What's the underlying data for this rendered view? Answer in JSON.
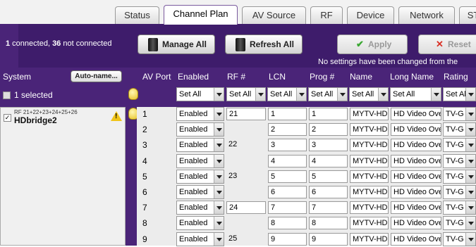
{
  "tabs": [
    "Status",
    "Channel Plan",
    "AV Source",
    "RF",
    "Device",
    "Network",
    "ST"
  ],
  "active_tab": "Channel Plan",
  "toolbar": {
    "connected_count": "1",
    "connected_label": " connected, ",
    "not_connected_count": "36",
    "not_connected_label": " not connected",
    "manage_all": "Manage All",
    "refresh_all": "Refresh All",
    "apply": "Apply",
    "reset": "Reset",
    "no_changes": "No settings have been changed from the"
  },
  "headers": {
    "system": "System",
    "auto_name": "Auto-name...",
    "av_port": "AV Port",
    "enabled": "Enabled",
    "rf": "RF #",
    "lcn": "LCN",
    "prog": "Prog #",
    "name": "Name",
    "long_name": "Long Name",
    "rating": "Rating"
  },
  "set_all": {
    "selected": "1 selected",
    "label": "Set All"
  },
  "device": {
    "rf_list": "RF 21+22+23+24+25+26",
    "name": "HDbridge2"
  },
  "rows": [
    {
      "port": "1",
      "enabled": "Enabled",
      "rf": "21",
      "rf_input": true,
      "lcn": "1",
      "prog": "1",
      "name": "MYTV-HD",
      "long_name": "HD Video Ove",
      "rating": "TV-G"
    },
    {
      "port": "2",
      "enabled": "Enabled",
      "rf": "",
      "rf_input": false,
      "lcn": "2",
      "prog": "2",
      "name": "MYTV-HD",
      "long_name": "HD Video Ove",
      "rating": "TV-G"
    },
    {
      "port": "3",
      "enabled": "Enabled",
      "rf": "22",
      "rf_input": false,
      "lcn": "3",
      "prog": "3",
      "name": "MYTV-HD",
      "long_name": "HD Video Ove",
      "rating": "TV-G"
    },
    {
      "port": "4",
      "enabled": "Enabled",
      "rf": "",
      "rf_input": false,
      "lcn": "4",
      "prog": "4",
      "name": "MYTV-HD",
      "long_name": "HD Video Ove",
      "rating": "TV-G"
    },
    {
      "port": "5",
      "enabled": "Enabled",
      "rf": "23",
      "rf_input": false,
      "lcn": "5",
      "prog": "5",
      "name": "MYTV-HD",
      "long_name": "HD Video Ove",
      "rating": "TV-G"
    },
    {
      "port": "6",
      "enabled": "Enabled",
      "rf": "",
      "rf_input": false,
      "lcn": "6",
      "prog": "6",
      "name": "MYTV-HD",
      "long_name": "HD Video Ove",
      "rating": "TV-G"
    },
    {
      "port": "7",
      "enabled": "Enabled",
      "rf": "24",
      "rf_input": true,
      "lcn": "7",
      "prog": "7",
      "name": "MYTV-HD",
      "long_name": "HD Video Ove",
      "rating": "TV-G"
    },
    {
      "port": "8",
      "enabled": "Enabled",
      "rf": "",
      "rf_input": false,
      "lcn": "8",
      "prog": "8",
      "name": "MYTV-HD",
      "long_name": "HD Video Ove",
      "rating": "TV-G"
    },
    {
      "port": "9",
      "enabled": "Enabled",
      "rf": "25",
      "rf_input": false,
      "lcn": "9",
      "prog": "9",
      "name": "MYTV-HD",
      "long_name": "HD Video Ove",
      "rating": "TV-G"
    }
  ],
  "colors": {
    "panel": "#4a2478",
    "toolbar": "#3e1c6b",
    "apply_check": "#3aa832",
    "reset_x": "#d93025"
  }
}
